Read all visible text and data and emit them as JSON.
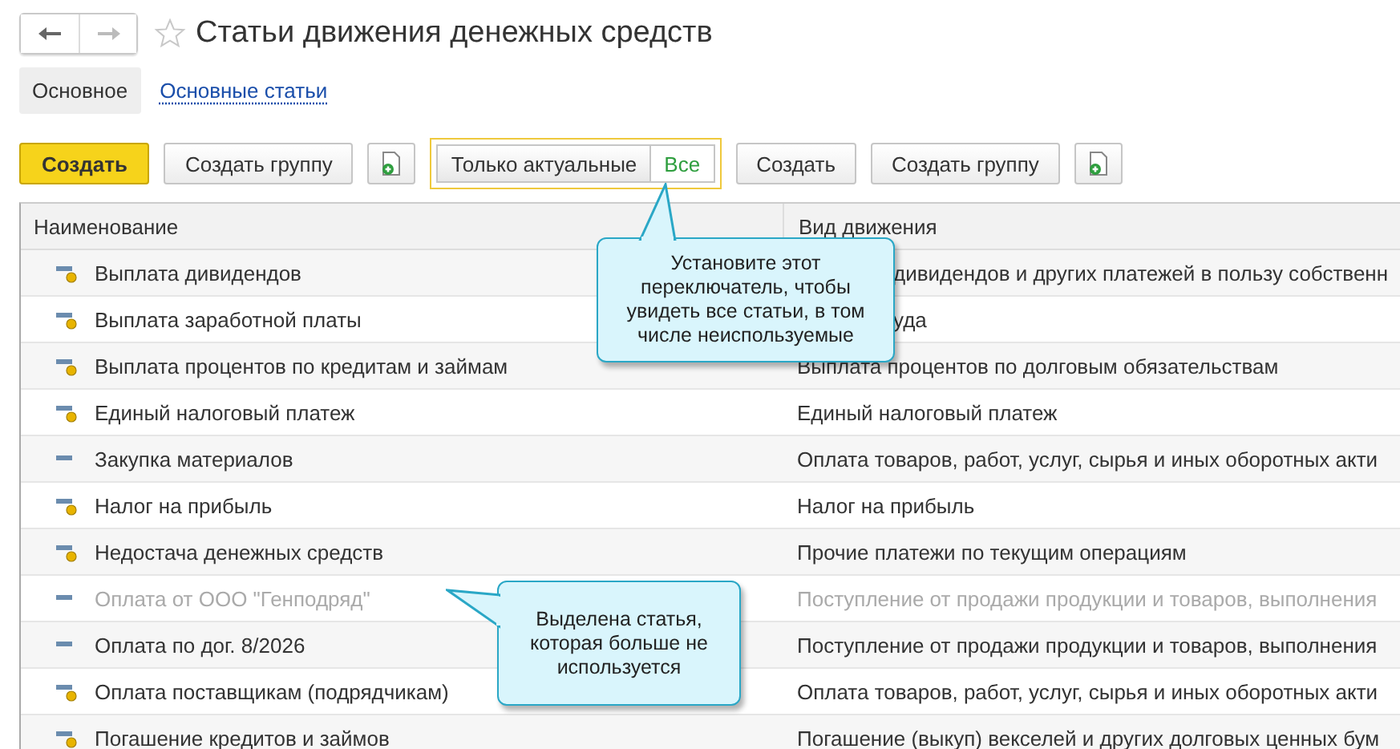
{
  "window": {
    "title": "Статьи движения денежных средств",
    "favorite": false
  },
  "tabs": [
    {
      "label": "Основное",
      "selected": true
    },
    {
      "label": "Основные статьи",
      "selected": false
    }
  ],
  "toolbar": {
    "buttons": [
      {
        "kind": "primary",
        "label": "Создать"
      },
      {
        "kind": "normal",
        "label": "Создать группу"
      },
      {
        "kind": "icon"
      }
    ],
    "filter": [
      {
        "label": "Только актуальные",
        "selected": false
      },
      {
        "label": "Все",
        "selected": true
      }
    ],
    "buttons_2": [
      {
        "kind": "normal",
        "label": "Создать"
      },
      {
        "kind": "normal",
        "label": "Создать группу"
      },
      {
        "kind": "icon"
      }
    ]
  },
  "table": {
    "columns": [
      "Наименование",
      "Вид движения"
    ],
    "rows": [
      {
        "kind": "item-marked",
        "name": "Выплата дивидендов",
        "movement": "дивидендов и других платежей в пользу собственн",
        "partly_hidden": true,
        "unused": false
      },
      {
        "kind": "item-marked",
        "name": "Выплата заработной платы",
        "movement": "уда",
        "partly_hidden": true,
        "unused": false
      },
      {
        "kind": "item-marked",
        "name": "Выплата процентов по кредитам и займам",
        "movement": "Выплата процентов по долговым обязательствам",
        "unused": false
      },
      {
        "kind": "item-marked",
        "name": "Единый налоговый платеж",
        "movement": "Единый налоговый платеж",
        "unused": false
      },
      {
        "kind": "item",
        "name": "Закупка материалов",
        "movement": "Оплата товаров, работ, услуг, сырья и иных оборотных акти",
        "unused": false
      },
      {
        "kind": "item-marked",
        "name": "Налог на прибыль",
        "movement": "Налог на прибыль",
        "unused": false
      },
      {
        "kind": "item-marked",
        "name": "Недостача денежных средств",
        "movement": "Прочие платежи по текущим операциям",
        "unused": false
      },
      {
        "kind": "item",
        "name": "Оплата от ООО \"Генподряд\"",
        "movement": "Поступление от продажи продукции и товаров, выполнения",
        "unused": true
      },
      {
        "kind": "item",
        "name": "Оплата по дог. 8/2026",
        "movement": "Поступление от продажи продукции и товаров, выполнения",
        "unused": false
      },
      {
        "kind": "item-marked",
        "name": "Оплата поставщикам (подрядчикам)",
        "movement": "Оплата товаров, работ, услуг, сырья и иных оборотных акти",
        "unused": false
      },
      {
        "kind": "item-marked",
        "name": "Погашение кредитов и займов",
        "movement": "Погашение (выкуп) векселей и других долговых ценных бум",
        "unused": false
      }
    ]
  },
  "callouts": [
    {
      "text": "Установите этот переключатель, чтобы увидеть все статьи, в том числе неиспользуемые"
    },
    {
      "text": "Выделена статья, которая больше не используется"
    }
  ]
}
